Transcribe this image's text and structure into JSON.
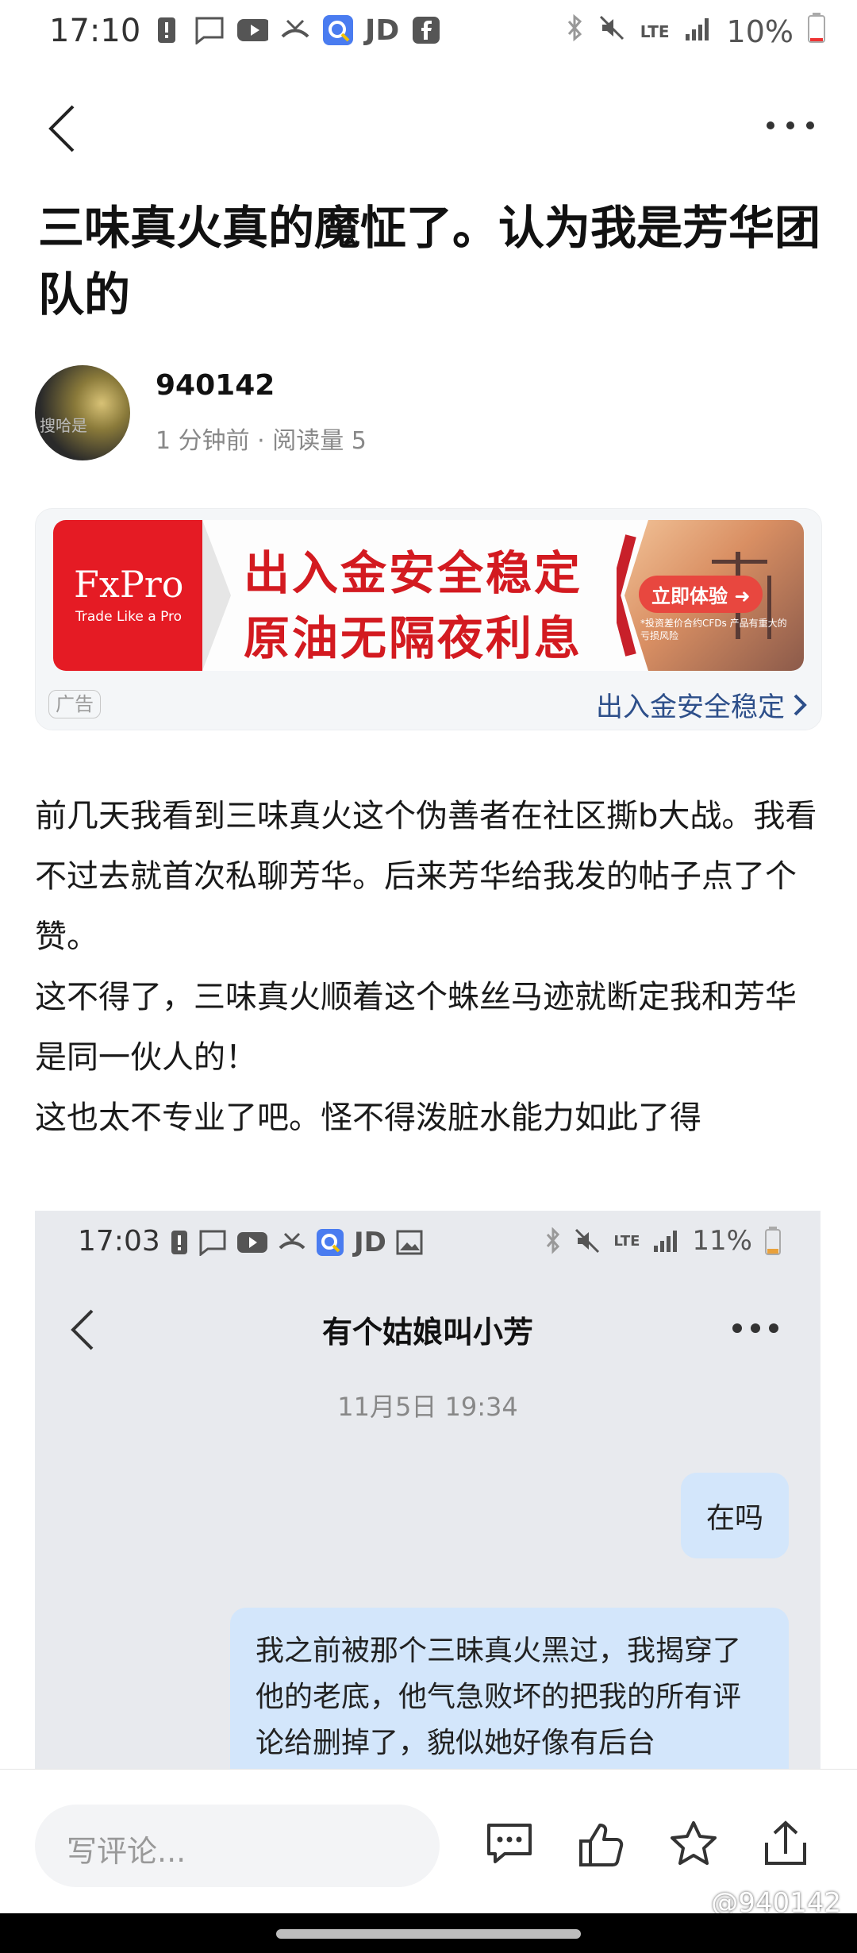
{
  "status_bar": {
    "time": "17:10",
    "icons": [
      "alert-icon",
      "message-icon",
      "youtube-icon",
      "missed-call-icon",
      "search-app-icon",
      "jd-icon",
      "facebook-icon"
    ],
    "jd_label": "JD",
    "lte_label": "LTE",
    "battery": "10%"
  },
  "article": {
    "title": "三味真火真的魔怔了。认为我是芳华团队的",
    "author": "940142",
    "meta": "1 分钟前 · 阅读量 5",
    "avatar_text": "搜哈是",
    "paragraphs": [
      " 前几天我看到三味真火这个伪善者在社区撕b大战。我看不过去就首次私聊芳华。后来芳华给我发的帖子点了个赞。",
      "这不得了，三味真火顺着这个蛛丝马迹就断定我和芳华是同一伙人的！",
      "这也太不专业了吧。怪不得泼脏水能力如此了得"
    ]
  },
  "ad": {
    "brand": "FxPro",
    "brand_sub": "Trade Like a Pro",
    "line1": "出入金安全稳定",
    "line2": "原油无隔夜利息",
    "cta": "立即体验 ➜",
    "fine_print": "*投资差价合约CFDs 产品有重大的亏损风险",
    "tag": "广告",
    "link": "出入金安全稳定"
  },
  "embedded_screenshot": {
    "time": "17:03",
    "jd_label": "JD",
    "lte_label": "LTE",
    "battery": "11%",
    "chat_title": "有个姑娘叫小芳",
    "date": "11月5日 19:34",
    "messages": [
      "在吗",
      "我之前被那个三昧真火黑过，我揭穿了他的老底，他气急败坏的把我的所有评论给删掉了，貌似她好像有后台"
    ]
  },
  "bottom_bar": {
    "comment_placeholder": "写评论...",
    "watermark": "@940142"
  },
  "colors": {
    "ad_red": "#d31a20",
    "link_blue": "#2d4f8a",
    "bubble": "#d3e6fb"
  }
}
